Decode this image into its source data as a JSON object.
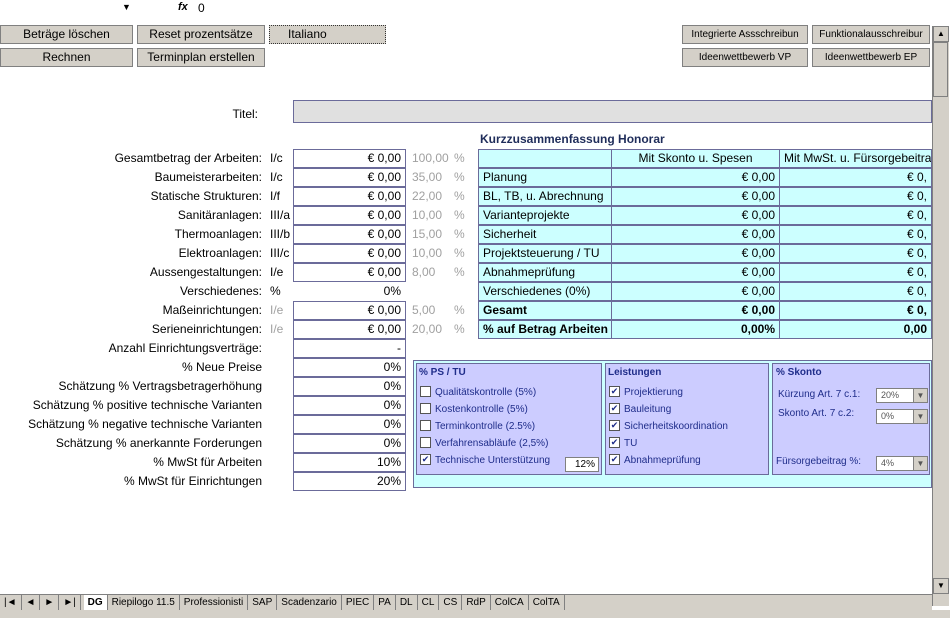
{
  "formula_bar": {
    "fx": "fx",
    "value": "0",
    "dropdown": "▼"
  },
  "buttons": {
    "betraege_loeschen": "Beträge löschen",
    "reset_prozentsaetze": "Reset prozentsätze",
    "italiano": "Italiano",
    "integrierte": "Integrierte Assschreibun",
    "funktional": "Funktionalausschreibur",
    "rechnen": "Rechnen",
    "terminplan": "Terminplan erstellen",
    "ideen_vp": "Ideenwettbewerb VP",
    "ideen_ep": "Ideenwettbewerb EP"
  },
  "titel_label": "Titel:",
  "rows": [
    {
      "label": "Gesamtbetrag der Arbeiten:",
      "code": "I/c",
      "amount": "€ 0,00",
      "pct": "100,00",
      "pct_sign": "%"
    },
    {
      "label": "Baumeisterarbeiten:",
      "code": "I/c",
      "amount": "€ 0,00",
      "pct": "35,00",
      "pct_sign": "%"
    },
    {
      "label": "Statische Strukturen:",
      "code": "I/f",
      "amount": "€ 0,00",
      "pct": "22,00",
      "pct_sign": "%"
    },
    {
      "label": "Sanitäranlagen:",
      "code": "III/a",
      "amount": "€ 0,00",
      "pct": "10,00",
      "pct_sign": "%"
    },
    {
      "label": "Thermoanlagen:",
      "code": "III/b",
      "amount": "€ 0,00",
      "pct": "15,00",
      "pct_sign": "%"
    },
    {
      "label": "Elektroanlagen:",
      "code": "III/c",
      "amount": "€ 0,00",
      "pct": "10,00",
      "pct_sign": "%"
    },
    {
      "label": "Aussengestaltungen:",
      "code": "I/e",
      "amount": "€ 0,00",
      "pct": "8,00",
      "pct_sign": "%"
    },
    {
      "label": "Verschiedenes:",
      "code": "%",
      "amount": "0%",
      "pct": "",
      "pct_sign": ""
    },
    {
      "label": "Maßeinrichtungen:",
      "code": "I/e",
      "amount": "€ 0,00",
      "pct": "5,00",
      "pct_sign": "%"
    },
    {
      "label": "Serieneinrichtungen:",
      "code": "I/e",
      "amount": "€ 0,00",
      "pct": "20,00",
      "pct_sign": "%"
    }
  ],
  "extra_rows": [
    {
      "label": "Anzahl Einrichtungsverträge:",
      "value": "-"
    },
    {
      "label": "% Neue Preise",
      "value": "0%"
    },
    {
      "label": "Schätzung % Vertragsbetragerhöhung",
      "value": "0%"
    },
    {
      "label": "Schätzung % positive technische Varianten",
      "value": "0%"
    },
    {
      "label": "Schätzung % negative technische Varianten",
      "value": "0%"
    },
    {
      "label": "Schätzung % anerkannte Forderungen",
      "value": "0%"
    },
    {
      "label": "% MwSt für Arbeiten",
      "value": "10%"
    },
    {
      "label": "% MwSt für Einrichtungen",
      "value": "20%"
    }
  ],
  "summary": {
    "title": "Kurzzusammenfassung Honorar",
    "col1": "Mit Skonto u. Spesen",
    "col2": "Mit MwSt. u. Fürsorgebeitra",
    "rows": [
      {
        "label": "Planung",
        "v1": "€ 0,00",
        "v2": "€ 0,"
      },
      {
        "label": "BL, TB, u. Abrechnung",
        "v1": "€ 0,00",
        "v2": "€ 0,"
      },
      {
        "label": "Varianteprojekte",
        "v1": "€ 0,00",
        "v2": "€ 0,"
      },
      {
        "label": "Sicherheit",
        "v1": "€ 0,00",
        "v2": "€ 0,"
      },
      {
        "label": "Projektsteuerung / TU",
        "v1": "€ 0,00",
        "v2": "€ 0,"
      },
      {
        "label": "Abnahmeprüfung",
        "v1": "€ 0,00",
        "v2": "€ 0,"
      },
      {
        "label": "Verschiedenes (0%)",
        "v1": "€ 0,00",
        "v2": "€ 0,"
      },
      {
        "label": "Gesamt",
        "v1": "€ 0,00",
        "v2": "€ 0,"
      },
      {
        "label": "% auf Betrag Arbeiten",
        "v1": "0,00%",
        "v2": "0,00"
      }
    ]
  },
  "ps_tu": {
    "title": "% PS / TU",
    "items": [
      {
        "label": "Qualitätskontrolle (5%)",
        "checked": false
      },
      {
        "label": "Kostenkontrolle (5%)",
        "checked": false
      },
      {
        "label": "Terminkontrolle (2.5%)",
        "checked": false
      },
      {
        "label": "Verfahrensabläufe (2,5%)",
        "checked": false
      },
      {
        "label": "Technische Unterstützung",
        "checked": true
      }
    ],
    "tech_value": "12%"
  },
  "leistungen": {
    "title": "Leistungen",
    "items": [
      {
        "label": "Projektierung",
        "checked": true
      },
      {
        "label": "Bauleitung",
        "checked": true
      },
      {
        "label": "Sicherheitskoordination",
        "checked": true
      },
      {
        "label": "TU",
        "checked": true
      },
      {
        "label": "Abnahmeprüfung",
        "checked": true
      }
    ]
  },
  "skonto": {
    "title": "% Skonto",
    "kuerzung_label": "Kürzung Art. 7 c.1:",
    "kuerzung_value": "20%",
    "skonto_label": "Skonto Art. 7 c.2:",
    "skonto_value": "0%",
    "fuersorge_label": "Fürsorgebeitrag %:",
    "fuersorge_value": "4%"
  },
  "sheet_tabs": [
    "DG",
    "Riepilogo 11.5",
    "Professionisti",
    "SAP",
    "Scadenzario",
    "PIEC",
    "PA",
    "DL",
    "CL",
    "CS",
    "RdP",
    "ColCA",
    "ColTA"
  ],
  "nav": {
    "first": "|◄",
    "prev": "◄",
    "next": "►",
    "last": "►|"
  }
}
